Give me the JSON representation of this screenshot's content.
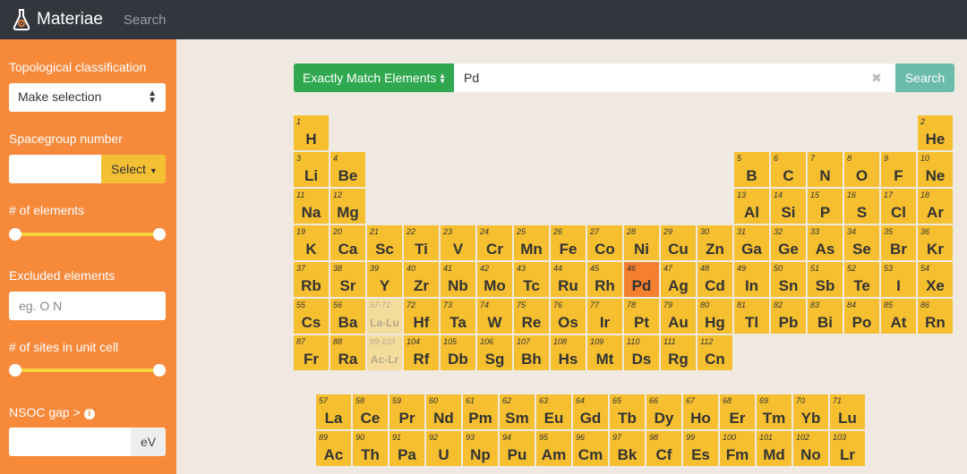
{
  "nav": {
    "brand": "Materiae",
    "search_link": "Search"
  },
  "sidebar": {
    "topo_label": "Topological classification",
    "topo_select": "Make selection",
    "spacegroup_label": "Spacegroup number",
    "spacegroup_value": "",
    "spacegroup_button": "Select",
    "elements_label": "# of elements",
    "excluded_label": "Excluded elements",
    "excluded_placeholder": "eg. O N",
    "sites_label": "# of sites in unit cell",
    "nsoc_label": "NSOC gap >",
    "nsoc_value": "",
    "nsoc_unit": "eV"
  },
  "search": {
    "mode_label": "Exactly Match Elements",
    "query": "Pd",
    "clear_icon": "close-icon",
    "button": "Search"
  },
  "colors": {
    "element": "#f5bf2f",
    "selected": "#f47f2f",
    "sidebar": "#f7893b",
    "match_button": "#2fa84f",
    "search_button": "#6cbcac"
  },
  "selected_element": "Pd",
  "table": [
    [
      1,
      "H",
      1,
      1
    ],
    [
      2,
      "He",
      18,
      1
    ],
    [
      3,
      "Li",
      1,
      2
    ],
    [
      4,
      "Be",
      2,
      2
    ],
    [
      5,
      "B",
      13,
      2
    ],
    [
      6,
      "C",
      14,
      2
    ],
    [
      7,
      "N",
      15,
      2
    ],
    [
      8,
      "O",
      16,
      2
    ],
    [
      9,
      "F",
      17,
      2
    ],
    [
      10,
      "Ne",
      18,
      2
    ],
    [
      11,
      "Na",
      1,
      3
    ],
    [
      12,
      "Mg",
      2,
      3
    ],
    [
      13,
      "Al",
      13,
      3
    ],
    [
      14,
      "Si",
      14,
      3
    ],
    [
      15,
      "P",
      15,
      3
    ],
    [
      16,
      "S",
      16,
      3
    ],
    [
      17,
      "Cl",
      17,
      3
    ],
    [
      18,
      "Ar",
      18,
      3
    ],
    [
      19,
      "K",
      1,
      4
    ],
    [
      20,
      "Ca",
      2,
      4
    ],
    [
      21,
      "Sc",
      3,
      4
    ],
    [
      22,
      "Ti",
      4,
      4
    ],
    [
      23,
      "V",
      5,
      4
    ],
    [
      24,
      "Cr",
      6,
      4
    ],
    [
      25,
      "Mn",
      7,
      4
    ],
    [
      26,
      "Fe",
      8,
      4
    ],
    [
      27,
      "Co",
      9,
      4
    ],
    [
      28,
      "Ni",
      10,
      4
    ],
    [
      29,
      "Cu",
      11,
      4
    ],
    [
      30,
      "Zn",
      12,
      4
    ],
    [
      31,
      "Ga",
      13,
      4
    ],
    [
      32,
      "Ge",
      14,
      4
    ],
    [
      33,
      "As",
      15,
      4
    ],
    [
      34,
      "Se",
      16,
      4
    ],
    [
      35,
      "Br",
      17,
      4
    ],
    [
      36,
      "Kr",
      18,
      4
    ],
    [
      37,
      "Rb",
      1,
      5
    ],
    [
      38,
      "Sr",
      2,
      5
    ],
    [
      39,
      "Y",
      3,
      5
    ],
    [
      40,
      "Zr",
      4,
      5
    ],
    [
      41,
      "Nb",
      5,
      5
    ],
    [
      42,
      "Mo",
      6,
      5
    ],
    [
      43,
      "Tc",
      7,
      5
    ],
    [
      44,
      "Ru",
      8,
      5
    ],
    [
      45,
      "Rh",
      9,
      5
    ],
    [
      46,
      "Pd",
      10,
      5
    ],
    [
      47,
      "Ag",
      11,
      5
    ],
    [
      48,
      "Cd",
      12,
      5
    ],
    [
      49,
      "In",
      13,
      5
    ],
    [
      50,
      "Sn",
      14,
      5
    ],
    [
      51,
      "Sb",
      15,
      5
    ],
    [
      52,
      "Te",
      16,
      5
    ],
    [
      53,
      "I",
      17,
      5
    ],
    [
      54,
      "Xe",
      18,
      5
    ],
    [
      55,
      "Cs",
      1,
      6
    ],
    [
      56,
      "Ba",
      2,
      6
    ],
    [
      "57-71",
      "La-Lu",
      3,
      6
    ],
    [
      72,
      "Hf",
      4,
      6
    ],
    [
      73,
      "Ta",
      5,
      6
    ],
    [
      74,
      "W",
      6,
      6
    ],
    [
      75,
      "Re",
      7,
      6
    ],
    [
      76,
      "Os",
      8,
      6
    ],
    [
      77,
      "Ir",
      9,
      6
    ],
    [
      78,
      "Pt",
      10,
      6
    ],
    [
      79,
      "Au",
      11,
      6
    ],
    [
      80,
      "Hg",
      12,
      6
    ],
    [
      81,
      "Tl",
      13,
      6
    ],
    [
      82,
      "Pb",
      14,
      6
    ],
    [
      83,
      "Bi",
      15,
      6
    ],
    [
      84,
      "Po",
      16,
      6
    ],
    [
      85,
      "At",
      17,
      6
    ],
    [
      86,
      "Rn",
      18,
      6
    ],
    [
      87,
      "Fr",
      1,
      7
    ],
    [
      88,
      "Ra",
      2,
      7
    ],
    [
      "89-103",
      "Ac-Lr",
      3,
      7
    ],
    [
      104,
      "Rf",
      4,
      7
    ],
    [
      105,
      "Db",
      5,
      7
    ],
    [
      106,
      "Sg",
      6,
      7
    ],
    [
      107,
      "Bh",
      7,
      7
    ],
    [
      108,
      "Hs",
      8,
      7
    ],
    [
      109,
      "Mt",
      9,
      7
    ],
    [
      110,
      "Ds",
      10,
      7
    ],
    [
      111,
      "Rg",
      11,
      7
    ],
    [
      112,
      "Cn",
      12,
      7
    ],
    [
      57,
      "La",
      1,
      9
    ],
    [
      58,
      "Ce",
      2,
      9
    ],
    [
      59,
      "Pr",
      3,
      9
    ],
    [
      60,
      "Nd",
      4,
      9
    ],
    [
      61,
      "Pm",
      5,
      9
    ],
    [
      62,
      "Sm",
      6,
      9
    ],
    [
      63,
      "Eu",
      7,
      9
    ],
    [
      64,
      "Gd",
      8,
      9
    ],
    [
      65,
      "Tb",
      9,
      9
    ],
    [
      66,
      "Dy",
      10,
      9
    ],
    [
      67,
      "Ho",
      11,
      9
    ],
    [
      68,
      "Er",
      12,
      9
    ],
    [
      69,
      "Tm",
      13,
      9
    ],
    [
      70,
      "Yb",
      14,
      9
    ],
    [
      71,
      "Lu",
      15,
      9
    ],
    [
      89,
      "Ac",
      1,
      10
    ],
    [
      90,
      "Th",
      2,
      10
    ],
    [
      91,
      "Pa",
      3,
      10
    ],
    [
      92,
      "U",
      4,
      10
    ],
    [
      93,
      "Np",
      5,
      10
    ],
    [
      94,
      "Pu",
      6,
      10
    ],
    [
      95,
      "Am",
      7,
      10
    ],
    [
      96,
      "Cm",
      8,
      10
    ],
    [
      97,
      "Bk",
      9,
      10
    ],
    [
      98,
      "Cf",
      10,
      10
    ],
    [
      99,
      "Es",
      11,
      10
    ],
    [
      100,
      "Fm",
      12,
      10
    ],
    [
      101,
      "Md",
      13,
      10
    ],
    [
      102,
      "No",
      14,
      10
    ],
    [
      103,
      "Lr",
      15,
      10
    ]
  ]
}
